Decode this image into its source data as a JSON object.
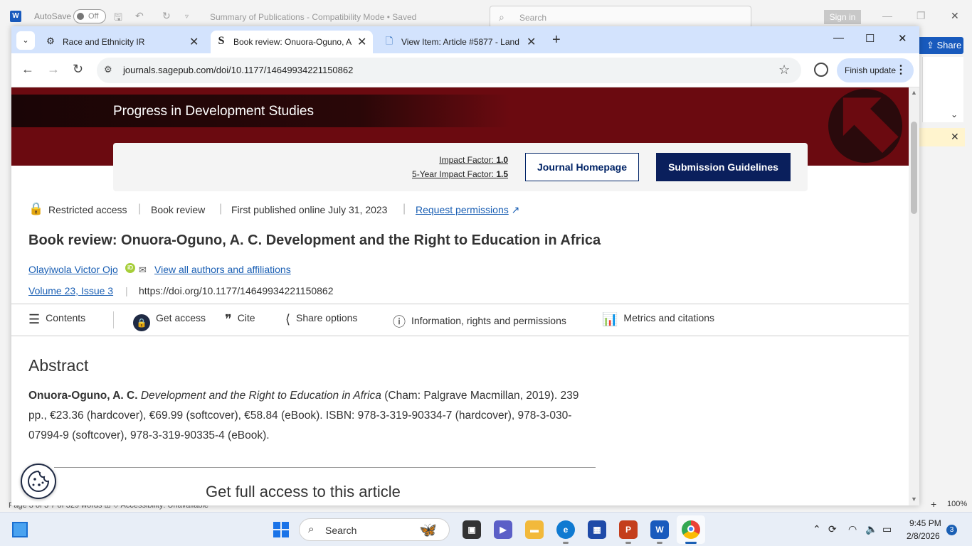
{
  "word": {
    "autosave_label": "AutoSave",
    "autosave_state": "Off",
    "doc_title": "Summary of Publications  -  Compatibility Mode  •  Saved",
    "search_placeholder": "Search",
    "signin_label": "Sign in",
    "share_label": "Share",
    "status_left": "Page 3 of 3     7 of 329 words     ⊞     ⛉ Accessibility: Unavailable",
    "zoom": "100%"
  },
  "chrome": {
    "tabs": [
      {
        "title": "Race and Ethnicity IR",
        "favicon": "openai-icon"
      },
      {
        "title": "Book review: Onuora-Oguno, A",
        "favicon": "sage-icon"
      },
      {
        "title": "View Item: Article #5877 - Land",
        "favicon": "document-icon"
      }
    ],
    "url": "journals.sagepub.com/doi/10.1177/14649934221150862",
    "finish_update_label": "Finish update"
  },
  "page": {
    "journal_title": "Progress in Development Studies",
    "impact_factor_label": "Impact Factor:",
    "impact_factor_value": "1.0",
    "five_year_label": "5-Year Impact Factor:",
    "five_year_value": "1.5",
    "journal_homepage_label": "Journal Homepage",
    "submission_label": "Submission Guidelines",
    "meta": {
      "access": "Restricted access",
      "type": "Book review",
      "published": "First published online July 31, 2023",
      "request_permissions": "Request permissions"
    },
    "article_title": "Book review: Onuora-Oguno, A. C. Development and the Right to Education in Africa",
    "author": "Olayiwola Victor Ojo",
    "view_authors": "View all authors and affiliations",
    "volume": "Volume 23, Issue 3",
    "doi": "https://doi.org/10.1177/14649934221150862",
    "actions": {
      "contents": "Contents",
      "get_access": "Get access",
      "cite": "Cite",
      "share": "Share options",
      "info": "Information, rights and permissions",
      "metrics": "Metrics and citations"
    },
    "abstract_heading": "Abstract",
    "abstract": {
      "author_bold": "Onuora-Oguno, A. C.",
      "book_italic": "Development and the Right to Education in Africa",
      "rest": " (Cham: Palgrave Macmillan, 2019). 239 pp., €23.36 (hardcover), €69.99 (softcover), €58.84 (eBook). ISBN: 978-3-319-90334-7 (hardcover), 978-3-030-07994-9 (softcover), 978-3-319-90335-4 (eBook)."
    },
    "full_access_heading": "Get full access to this article"
  },
  "taskbar": {
    "search_placeholder": "Search",
    "time": "9:45 PM",
    "date": "2/8/2026",
    "notification_count": "3"
  },
  "colors": {
    "banner": "#6b0a10",
    "navy_button": "#0a1f5c",
    "link": "#1a5fb4",
    "chrome_tabstrip": "#d3e3fd"
  }
}
